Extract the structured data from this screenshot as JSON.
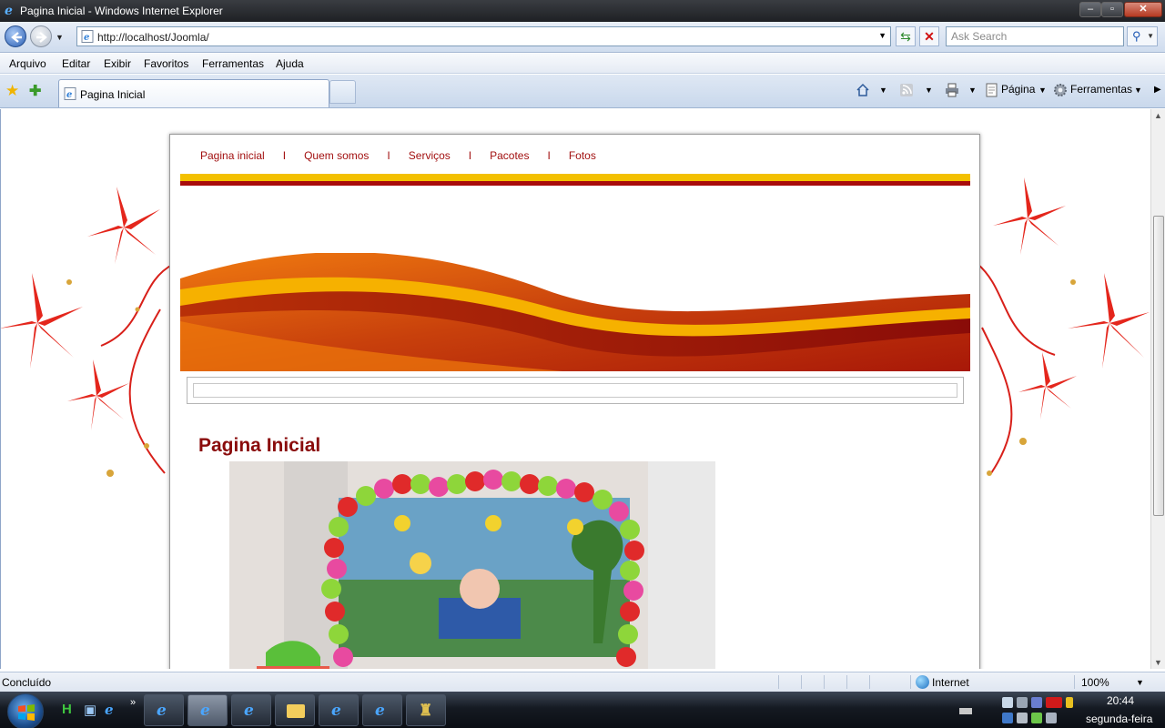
{
  "window": {
    "title": "Pagina Inicial - Windows Internet Explorer"
  },
  "address_bar": {
    "url": "http://localhost/Joomla/",
    "search_placeholder": "Ask Search"
  },
  "menu": [
    "Arquivo",
    "Editar",
    "Exibir",
    "Favoritos",
    "Ferramentas",
    "Ajuda"
  ],
  "tab": {
    "label": "Pagina Inicial"
  },
  "command_bar": {
    "page_label": "Página",
    "tools_label": "Ferramentas"
  },
  "site": {
    "nav": [
      "Pagina inicial",
      "Quem somos",
      "Serviços",
      "Pacotes",
      "Fotos"
    ],
    "nav_separator": "I",
    "heading": "Pagina Inicial",
    "colors": {
      "link": "#a21010",
      "stripe_yellow": "#f3c000",
      "stripe_red": "#a80c0c",
      "heading": "#8a0c0c"
    }
  },
  "status_bar": {
    "status": "Concluído",
    "zone": "Internet",
    "zoom": "100%"
  },
  "taskbar": {
    "time": "20:44",
    "day": "segunda-feira"
  }
}
